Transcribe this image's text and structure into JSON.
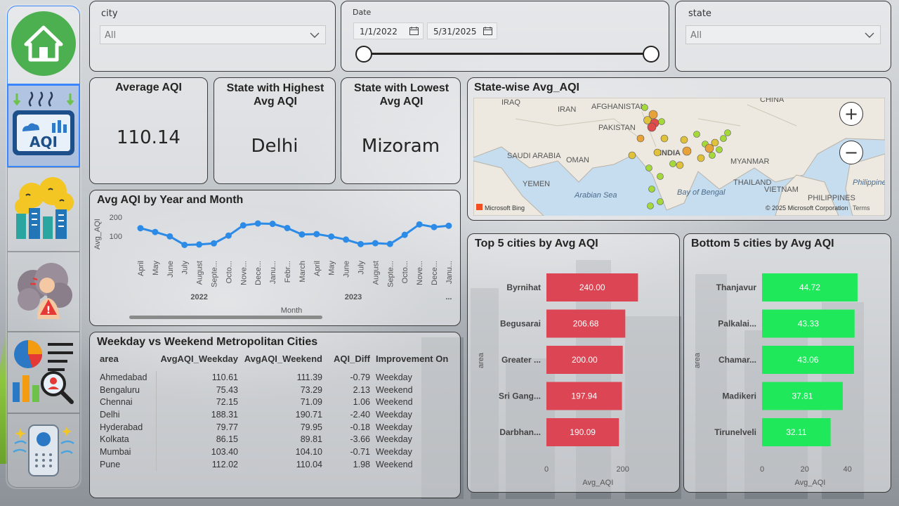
{
  "filters": {
    "city": {
      "label": "city",
      "value": "All"
    },
    "date": {
      "label": "Date",
      "start": "1/1/2022",
      "end": "5/31/2025",
      "range_start": 0.0,
      "range_end": 1.0
    },
    "state": {
      "label": "state",
      "value": "All"
    }
  },
  "kpis": {
    "average_aqi": {
      "title": "Average AQI",
      "value": "110.14"
    },
    "highest_state": {
      "title": "State with Highest Avg AQI",
      "value": "Delhi"
    },
    "lowest_state": {
      "title": "State with Lowest Avg AQI",
      "value": "Mizoram"
    }
  },
  "map": {
    "title": "State-wise Avg_AQI",
    "labels": [
      "IRAQ",
      "IRAN",
      "AFGHANISTAN",
      "PAKISTAN",
      "SAUDI ARABIA",
      "OMAN",
      "YEMEN",
      "Arabian Sea",
      "INDIA",
      "Bay of Bengal",
      "CHINA",
      "MYANMAR",
      "THAILAND",
      "VIETNAM",
      "PHILIPPINES",
      "Philippine"
    ],
    "bing_label": "Microsoft Bing",
    "copyright": "© 2025 Microsoft Corporation",
    "terms": "Terms",
    "zoom_in": "+",
    "zoom_out": "−",
    "colors": {
      "high": "#e04b4b",
      "mid": "#e8a23a",
      "low": "#a5d839"
    }
  },
  "chart_data": [
    {
      "type": "line",
      "title": "Avg AQI by Year and Month",
      "xlabel": "Month",
      "ylabel": "Avg_AQI",
      "yticks": [
        100,
        200
      ],
      "ylim": [
        0,
        230
      ],
      "categories": [
        "April",
        "May",
        "June",
        "July",
        "August",
        "Septe...",
        "Octo...",
        "Nove...",
        "Dece...",
        "Janu...",
        "Febr...",
        "March",
        "April",
        "May",
        "June",
        "July",
        "August",
        "Septe...",
        "Octo...",
        "Nove...",
        "Dece...",
        "Janu..."
      ],
      "years": [
        {
          "label": "2022",
          "start": 0,
          "end": 8
        },
        {
          "label": "2023",
          "start": 9,
          "end": 20
        }
      ],
      "overflow_label": "...",
      "values": [
        142,
        122,
        99,
        54,
        56,
        62,
        103,
        157,
        167,
        165,
        143,
        109,
        111,
        98,
        82,
        58,
        63,
        59,
        107,
        162,
        148,
        155
      ],
      "color": "#2d8be8"
    },
    {
      "type": "bar",
      "title": "Top 5 cities by Avg AQI",
      "xlabel": "Avg_AQI",
      "ylabel": "area",
      "categories": [
        "Byrnihat",
        "Begusarai",
        "Greater ...",
        "Sri Gang...",
        "Darbhan..."
      ],
      "values": [
        240.0,
        206.68,
        200.0,
        197.94,
        190.09
      ],
      "value_labels": [
        "240.00",
        "206.68",
        "200.00",
        "197.94",
        "190.09"
      ],
      "xticks": [
        0,
        200
      ],
      "xlim": [
        0,
        300
      ],
      "color": "#dc4553"
    },
    {
      "type": "bar",
      "title": "Bottom 5 cities by Avg AQI",
      "xlabel": "Avg_AQI",
      "ylabel": "area",
      "categories": [
        "Thanjavur",
        "Palkalai...",
        "Chamar...",
        "Madikeri",
        "Tirunelveli"
      ],
      "values": [
        44.72,
        43.33,
        43.06,
        37.81,
        32.11
      ],
      "value_labels": [
        "44.72",
        "43.33",
        "43.06",
        "37.81",
        "32.11"
      ],
      "xticks": [
        0,
        20,
        40
      ],
      "xlim": [
        0,
        50
      ],
      "color": "#1fe85a"
    }
  ],
  "table": {
    "title": "Weekday vs Weekend Metropolitan Cities",
    "columns": [
      "area",
      "AvgAQI_Weekday",
      "AvgAQI_Weekend",
      "AQI_Diff",
      "Improvement On"
    ],
    "rows": [
      [
        "Ahmedabad",
        "110.61",
        "111.39",
        "-0.79",
        "Weekday"
      ],
      [
        "Bengaluru",
        "75.43",
        "73.29",
        "2.13",
        "Weekend"
      ],
      [
        "Chennai",
        "72.15",
        "71.09",
        "1.06",
        "Weekend"
      ],
      [
        "Delhi",
        "188.31",
        "190.71",
        "-2.40",
        "Weekday"
      ],
      [
        "Hyderabad",
        "79.77",
        "79.95",
        "-0.18",
        "Weekday"
      ],
      [
        "Kolkata",
        "86.15",
        "89.81",
        "-3.66",
        "Weekday"
      ],
      [
        "Mumbai",
        "103.40",
        "104.10",
        "-0.71",
        "Weekday"
      ],
      [
        "Pune",
        "112.02",
        "110.04",
        "1.98",
        "Weekend"
      ]
    ]
  },
  "sidebar": {
    "items": [
      {
        "icon": "home-icon",
        "active": false
      },
      {
        "icon": "aqi-monitor-icon",
        "label": "AQI",
        "active": true
      },
      {
        "icon": "polluted-city-icon",
        "active": false
      },
      {
        "icon": "health-warning-icon",
        "active": false
      },
      {
        "icon": "analytics-report-icon",
        "active": false
      },
      {
        "icon": "air-purifier-icon",
        "active": false
      }
    ]
  }
}
